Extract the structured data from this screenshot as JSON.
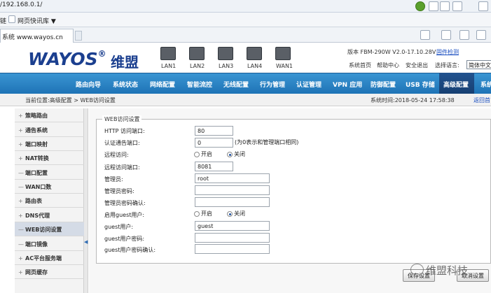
{
  "browser": {
    "address": "/192.168.0.1/",
    "fav_label": "链",
    "fav_item": "网页快讯库 ▼",
    "tab_title": "系统 www.wayos.cn"
  },
  "header": {
    "logo": "WAYOS",
    "logo_reg": "®",
    "logo_cn": "维盟",
    "ports": [
      "LAN1",
      "LAN2",
      "LAN3",
      "LAN4",
      "WAN1"
    ],
    "version": "版本 FBM-290W V2.0-17.10.28V",
    "upgrade": "固件检测",
    "links": [
      "系统首页",
      "帮助中心",
      "安全退出",
      "选择语言:"
    ],
    "language": "简体中文"
  },
  "nav": {
    "items": [
      "路由向导",
      "系统状态",
      "网络配置",
      "智能流控",
      "无线配置",
      "行为管理",
      "认证管理",
      "VPN 应用",
      "防御配置",
      "USB 存储",
      "高级配置",
      "系统"
    ]
  },
  "breadcrumb": {
    "text": "当前位置:高级配置 > WEB访问设置",
    "time": "系统时间:2018-05-24 17:58:38",
    "back": "返回首"
  },
  "sidebar": {
    "items": [
      {
        "mark": "+",
        "label": "策略路由"
      },
      {
        "mark": "+",
        "label": "通告系统"
      },
      {
        "mark": "+",
        "label": "端口映射"
      },
      {
        "mark": "+",
        "label": "NAT转换"
      },
      {
        "mark": "—",
        "label": "端口配置"
      },
      {
        "mark": "—",
        "label": "WAN口数"
      },
      {
        "mark": "+",
        "label": "路由表"
      },
      {
        "mark": "+",
        "label": "DNS代理"
      },
      {
        "mark": "—",
        "label": "WEB访问设置"
      },
      {
        "mark": "—",
        "label": "端口镜像"
      },
      {
        "mark": "+",
        "label": "AC平台服务端"
      },
      {
        "mark": "+",
        "label": "网页缓存"
      }
    ]
  },
  "form": {
    "legend": "WEB访问设置",
    "http_port_label": "HTTP 访问端口:",
    "http_port": "80",
    "auth_port_label": "认证通告端口:",
    "auth_port": "0",
    "auth_note": "(为0表示和管理端口相同)",
    "remote_label": "远程访问:",
    "on_label": "开启",
    "off_label": "关闭",
    "remote_port_label": "远程访问端口:",
    "remote_port": "8081",
    "admin_label": "管理员:",
    "admin": "root",
    "admin_pwd_label": "管理员密码:",
    "admin_pwd_confirm_label": "管理员密码确认:",
    "guest_enable_label": "启用guest用户:",
    "guest_user_label": "guest用户:",
    "guest_user": "guest",
    "guest_pwd_label": "guest用户密码:",
    "guest_pwd_confirm_label": "guest用户密码确认:",
    "save_label": "保存设置",
    "cancel_label": "取消设置"
  },
  "watermark": "维盟科技",
  "colors": {
    "nav_blue": "#1e73b6",
    "logo_blue": "#1b3f8f",
    "nav_active": "#163f72"
  }
}
